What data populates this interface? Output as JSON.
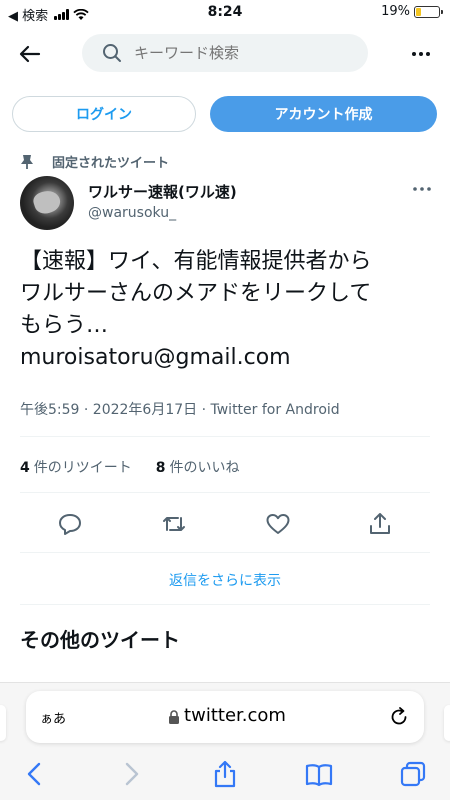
{
  "status_bar": {
    "carrier": "◀ 検索",
    "time": "8:24",
    "battery": "19%",
    "battery_level": 0.19
  },
  "header": {
    "search_placeholder": "キーワード検索"
  },
  "auth": {
    "login_label": "ログイン",
    "signup_label": "アカウント作成"
  },
  "tweet": {
    "pinned_label": "固定されたツイート",
    "author_name": "ワルサー速報(ワル速)",
    "author_handle": "@warusoku_",
    "text": "【速報】ワイ、有能情報提供者から\nワルサーさんのメアドをリークして\nもらう…\nmuroisatoru@gmail.com",
    "meta": "午後5:59 · 2022年6月17日 · Twitter for Android",
    "retweet_count": "4",
    "retweet_label": "件のリツイート",
    "like_count": "8",
    "like_label": "件のいいね"
  },
  "more_replies": "返信をさらに表示",
  "other_tweets_title": "その他のツイート",
  "safari": {
    "aa_label": "ぁあ",
    "url": "twitter.com"
  },
  "colors": {
    "accent": "#1d9bf0",
    "signup_bg": "#4a9ce8",
    "secondary_text": "#536471",
    "safari_blue": "#3478f6"
  }
}
